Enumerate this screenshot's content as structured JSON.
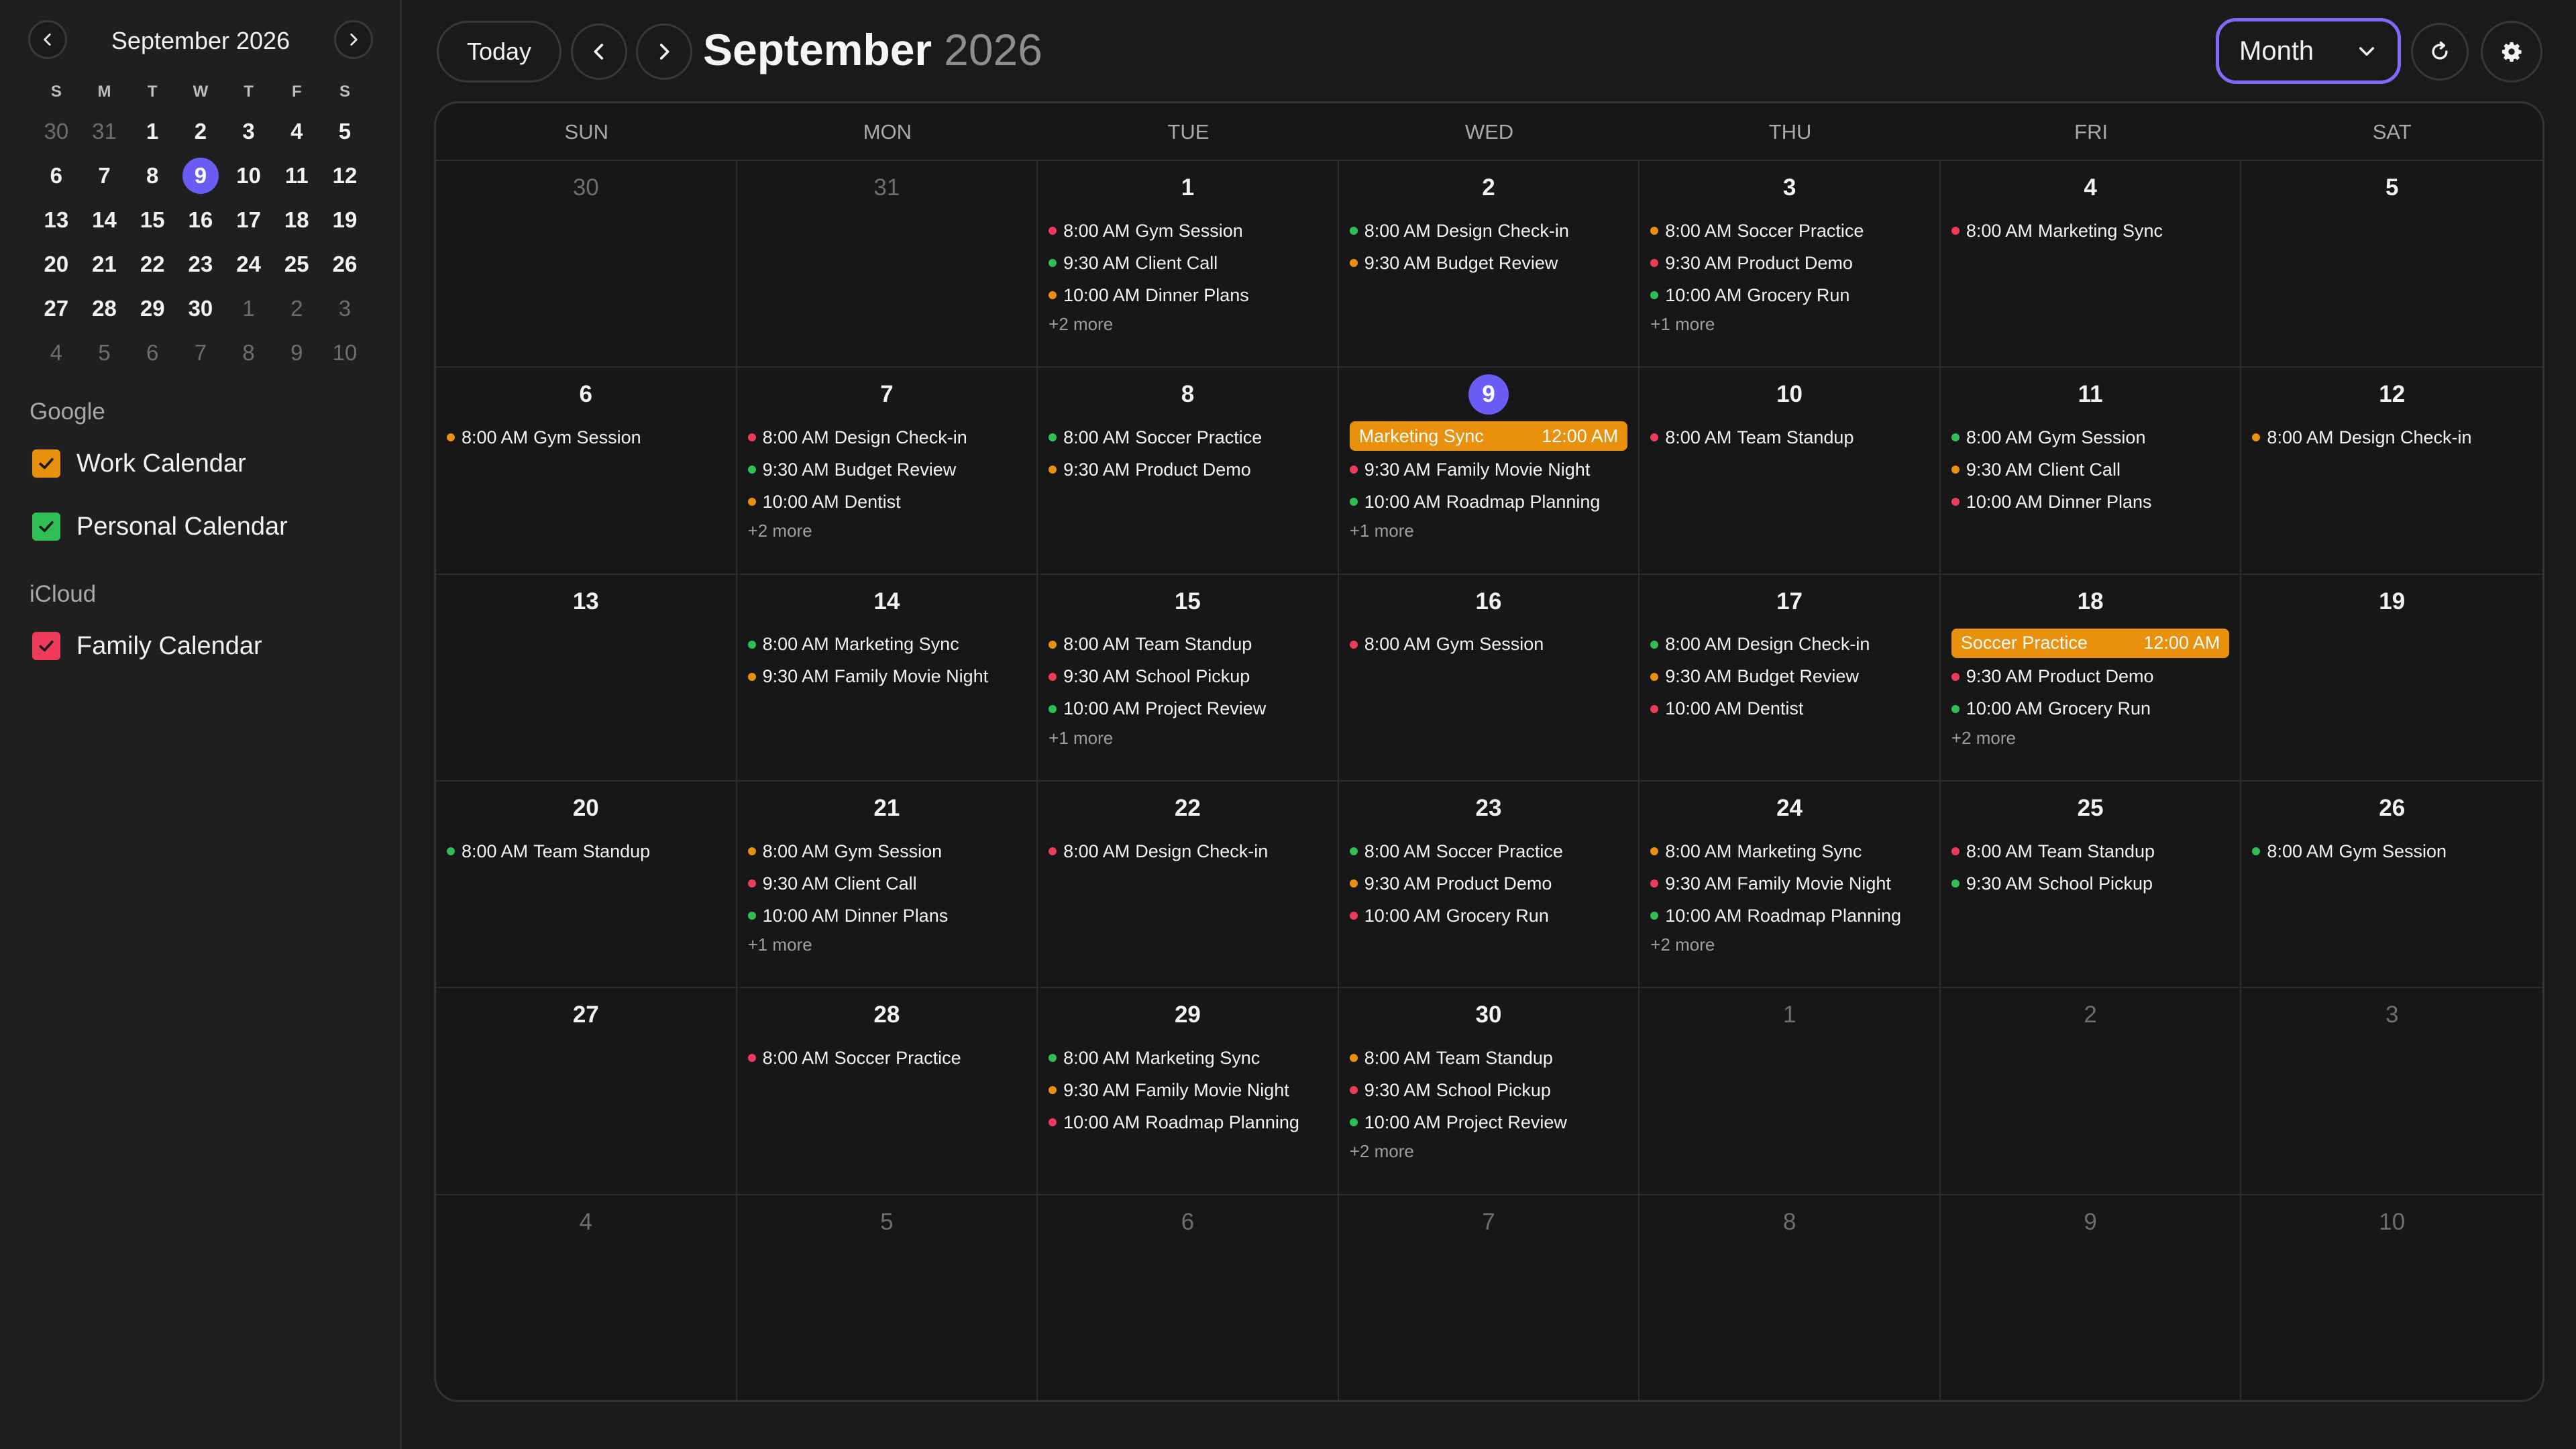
{
  "mini_calendar": {
    "title": "September 2026",
    "dow": [
      "S",
      "M",
      "T",
      "W",
      "T",
      "F",
      "S"
    ],
    "days": [
      {
        "n": "30",
        "muted": true
      },
      {
        "n": "31",
        "muted": true
      },
      {
        "n": "1"
      },
      {
        "n": "2"
      },
      {
        "n": "3"
      },
      {
        "n": "4"
      },
      {
        "n": "5"
      },
      {
        "n": "6"
      },
      {
        "n": "7"
      },
      {
        "n": "8"
      },
      {
        "n": "9",
        "today": true
      },
      {
        "n": "10"
      },
      {
        "n": "11"
      },
      {
        "n": "12"
      },
      {
        "n": "13"
      },
      {
        "n": "14"
      },
      {
        "n": "15"
      },
      {
        "n": "16"
      },
      {
        "n": "17"
      },
      {
        "n": "18"
      },
      {
        "n": "19"
      },
      {
        "n": "20"
      },
      {
        "n": "21"
      },
      {
        "n": "22"
      },
      {
        "n": "23"
      },
      {
        "n": "24"
      },
      {
        "n": "25"
      },
      {
        "n": "26"
      },
      {
        "n": "27"
      },
      {
        "n": "28"
      },
      {
        "n": "29"
      },
      {
        "n": "30"
      },
      {
        "n": "1",
        "muted": true
      },
      {
        "n": "2",
        "muted": true
      },
      {
        "n": "3",
        "muted": true
      },
      {
        "n": "4",
        "muted": true
      },
      {
        "n": "5",
        "muted": true
      },
      {
        "n": "6",
        "muted": true
      },
      {
        "n": "7",
        "muted": true
      },
      {
        "n": "8",
        "muted": true
      },
      {
        "n": "9",
        "muted": true
      },
      {
        "n": "10",
        "muted": true
      }
    ],
    "prev_icon": "chevron-left-icon",
    "next_icon": "chevron-right-icon"
  },
  "calendar_groups": [
    {
      "label": "Google",
      "calendars": [
        {
          "name": "Work Calendar",
          "color": "#e9900d",
          "checked": true
        },
        {
          "name": "Personal Calendar",
          "color": "#2fbf55",
          "checked": true
        }
      ]
    },
    {
      "label": "iCloud",
      "calendars": [
        {
          "name": "Family Calendar",
          "color": "#ee3b5b",
          "checked": true
        }
      ]
    }
  ],
  "toolbar": {
    "today_label": "Today",
    "month": "September",
    "year": "2026",
    "view": "Month",
    "icons": [
      "chevron-left-icon",
      "chevron-right-icon",
      "chevron-down-icon",
      "refresh-icon",
      "gear-icon"
    ]
  },
  "colors": {
    "accent": "#6b5cf5",
    "work": "#e9900d",
    "personal": "#2fbf55",
    "family": "#ee3b5b"
  },
  "grid": {
    "dow": [
      "SUN",
      "MON",
      "TUE",
      "WED",
      "THU",
      "FRI",
      "SAT"
    ],
    "cells": [
      {
        "d": "30",
        "muted": true,
        "events": []
      },
      {
        "d": "31",
        "muted": true,
        "events": []
      },
      {
        "d": "1",
        "events": [
          {
            "t": "8:00 AM",
            "n": "Gym Session",
            "c": "#ee3b5b"
          },
          {
            "t": "9:30 AM",
            "n": "Client Call",
            "c": "#2fbf55"
          },
          {
            "t": "10:00 AM",
            "n": "Dinner Plans",
            "c": "#e9900d"
          }
        ],
        "more": "+2 more"
      },
      {
        "d": "2",
        "events": [
          {
            "t": "8:00 AM",
            "n": "Design Check-in",
            "c": "#2fbf55"
          },
          {
            "t": "9:30 AM",
            "n": "Budget Review",
            "c": "#e9900d"
          }
        ]
      },
      {
        "d": "3",
        "events": [
          {
            "t": "8:00 AM",
            "n": "Soccer Practice",
            "c": "#e9900d"
          },
          {
            "t": "9:30 AM",
            "n": "Product Demo",
            "c": "#ee3b5b"
          },
          {
            "t": "10:00 AM",
            "n": "Grocery Run",
            "c": "#2fbf55"
          }
        ],
        "more": "+1 more"
      },
      {
        "d": "4",
        "events": [
          {
            "t": "8:00 AM",
            "n": "Marketing Sync",
            "c": "#ee3b5b"
          }
        ]
      },
      {
        "d": "5",
        "events": []
      },
      {
        "d": "6",
        "events": [
          {
            "t": "8:00 AM",
            "n": "Gym Session",
            "c": "#e9900d"
          }
        ]
      },
      {
        "d": "7",
        "events": [
          {
            "t": "8:00 AM",
            "n": "Design Check-in",
            "c": "#ee3b5b"
          },
          {
            "t": "9:30 AM",
            "n": "Budget Review",
            "c": "#2fbf55"
          },
          {
            "t": "10:00 AM",
            "n": "Dentist",
            "c": "#e9900d"
          }
        ],
        "more": "+2 more"
      },
      {
        "d": "8",
        "events": [
          {
            "t": "8:00 AM",
            "n": "Soccer Practice",
            "c": "#2fbf55"
          },
          {
            "t": "9:30 AM",
            "n": "Product Demo",
            "c": "#e9900d"
          }
        ]
      },
      {
        "d": "9",
        "today": true,
        "allday": {
          "n": "Marketing Sync",
          "t": "12:00 AM"
        },
        "events": [
          {
            "t": "9:30 AM",
            "n": "Family Movie Night",
            "c": "#ee3b5b"
          },
          {
            "t": "10:00 AM",
            "n": "Roadmap Planning",
            "c": "#2fbf55"
          }
        ],
        "more": "+1 more"
      },
      {
        "d": "10",
        "events": [
          {
            "t": "8:00 AM",
            "n": "Team Standup",
            "c": "#ee3b5b"
          }
        ]
      },
      {
        "d": "11",
        "events": [
          {
            "t": "8:00 AM",
            "n": "Gym Session",
            "c": "#2fbf55"
          },
          {
            "t": "9:30 AM",
            "n": "Client Call",
            "c": "#e9900d"
          },
          {
            "t": "10:00 AM",
            "n": "Dinner Plans",
            "c": "#ee3b5b"
          }
        ]
      },
      {
        "d": "12",
        "events": [
          {
            "t": "8:00 AM",
            "n": "Design Check-in",
            "c": "#e9900d"
          }
        ]
      },
      {
        "d": "13",
        "events": []
      },
      {
        "d": "14",
        "events": [
          {
            "t": "8:00 AM",
            "n": "Marketing Sync",
            "c": "#2fbf55"
          },
          {
            "t": "9:30 AM",
            "n": "Family Movie Night",
            "c": "#e9900d"
          }
        ]
      },
      {
        "d": "15",
        "events": [
          {
            "t": "8:00 AM",
            "n": "Team Standup",
            "c": "#e9900d"
          },
          {
            "t": "9:30 AM",
            "n": "School Pickup",
            "c": "#ee3b5b"
          },
          {
            "t": "10:00 AM",
            "n": "Project Review",
            "c": "#2fbf55"
          }
        ],
        "more": "+1 more"
      },
      {
        "d": "16",
        "events": [
          {
            "t": "8:00 AM",
            "n": "Gym Session",
            "c": "#ee3b5b"
          }
        ]
      },
      {
        "d": "17",
        "events": [
          {
            "t": "8:00 AM",
            "n": "Design Check-in",
            "c": "#2fbf55"
          },
          {
            "t": "9:30 AM",
            "n": "Budget Review",
            "c": "#e9900d"
          },
          {
            "t": "10:00 AM",
            "n": "Dentist",
            "c": "#ee3b5b"
          }
        ]
      },
      {
        "d": "18",
        "allday": {
          "n": "Soccer Practice",
          "t": "12:00 AM"
        },
        "events": [
          {
            "t": "9:30 AM",
            "n": "Product Demo",
            "c": "#ee3b5b"
          },
          {
            "t": "10:00 AM",
            "n": "Grocery Run",
            "c": "#2fbf55"
          }
        ],
        "more": "+2 more"
      },
      {
        "d": "19",
        "events": []
      },
      {
        "d": "20",
        "events": [
          {
            "t": "8:00 AM",
            "n": "Team Standup",
            "c": "#2fbf55"
          }
        ]
      },
      {
        "d": "21",
        "events": [
          {
            "t": "8:00 AM",
            "n": "Gym Session",
            "c": "#e9900d"
          },
          {
            "t": "9:30 AM",
            "n": "Client Call",
            "c": "#ee3b5b"
          },
          {
            "t": "10:00 AM",
            "n": "Dinner Plans",
            "c": "#2fbf55"
          }
        ],
        "more": "+1 more"
      },
      {
        "d": "22",
        "events": [
          {
            "t": "8:00 AM",
            "n": "Design Check-in",
            "c": "#ee3b5b"
          }
        ]
      },
      {
        "d": "23",
        "events": [
          {
            "t": "8:00 AM",
            "n": "Soccer Practice",
            "c": "#2fbf55"
          },
          {
            "t": "9:30 AM",
            "n": "Product Demo",
            "c": "#e9900d"
          },
          {
            "t": "10:00 AM",
            "n": "Grocery Run",
            "c": "#ee3b5b"
          }
        ]
      },
      {
        "d": "24",
        "events": [
          {
            "t": "8:00 AM",
            "n": "Marketing Sync",
            "c": "#e9900d"
          },
          {
            "t": "9:30 AM",
            "n": "Family Movie Night",
            "c": "#ee3b5b"
          },
          {
            "t": "10:00 AM",
            "n": "Roadmap Planning",
            "c": "#2fbf55"
          }
        ],
        "more": "+2 more"
      },
      {
        "d": "25",
        "events": [
          {
            "t": "8:00 AM",
            "n": "Team Standup",
            "c": "#ee3b5b"
          },
          {
            "t": "9:30 AM",
            "n": "School Pickup",
            "c": "#2fbf55"
          }
        ]
      },
      {
        "d": "26",
        "events": [
          {
            "t": "8:00 AM",
            "n": "Gym Session",
            "c": "#2fbf55"
          }
        ]
      },
      {
        "d": "27",
        "events": []
      },
      {
        "d": "28",
        "events": [
          {
            "t": "8:00 AM",
            "n": "Soccer Practice",
            "c": "#ee3b5b"
          }
        ]
      },
      {
        "d": "29",
        "events": [
          {
            "t": "8:00 AM",
            "n": "Marketing Sync",
            "c": "#2fbf55"
          },
          {
            "t": "9:30 AM",
            "n": "Family Movie Night",
            "c": "#e9900d"
          },
          {
            "t": "10:00 AM",
            "n": "Roadmap Planning",
            "c": "#ee3b5b"
          }
        ]
      },
      {
        "d": "30",
        "events": [
          {
            "t": "8:00 AM",
            "n": "Team Standup",
            "c": "#e9900d"
          },
          {
            "t": "9:30 AM",
            "n": "School Pickup",
            "c": "#ee3b5b"
          },
          {
            "t": "10:00 AM",
            "n": "Project Review",
            "c": "#2fbf55"
          }
        ],
        "more": "+2 more"
      },
      {
        "d": "1",
        "muted": true,
        "events": []
      },
      {
        "d": "2",
        "muted": true,
        "events": []
      },
      {
        "d": "3",
        "muted": true,
        "events": []
      },
      {
        "d": "4",
        "muted": true,
        "events": []
      },
      {
        "d": "5",
        "muted": true,
        "events": []
      },
      {
        "d": "6",
        "muted": true,
        "events": []
      },
      {
        "d": "7",
        "muted": true,
        "events": []
      },
      {
        "d": "8",
        "muted": true,
        "events": []
      },
      {
        "d": "9",
        "muted": true,
        "events": []
      },
      {
        "d": "10",
        "muted": true,
        "events": []
      }
    ]
  }
}
